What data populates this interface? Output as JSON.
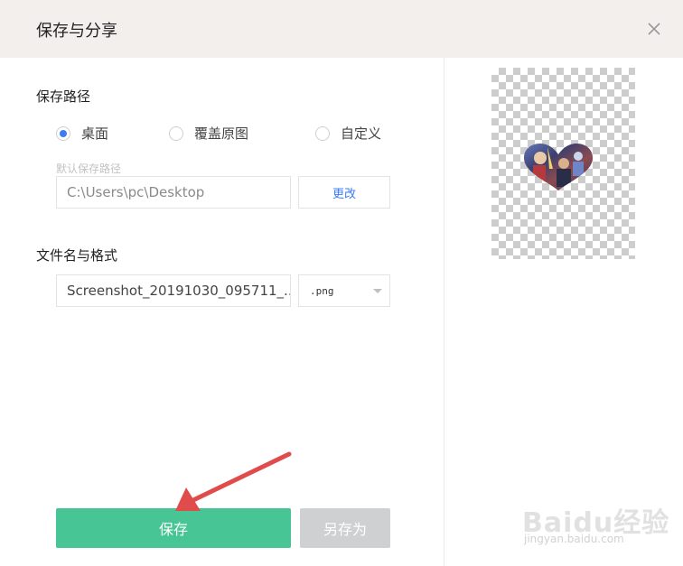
{
  "dialog": {
    "title": "保存与分享"
  },
  "save_path": {
    "label": "保存路径",
    "options": [
      {
        "label": "桌面",
        "selected": true
      },
      {
        "label": "覆盖原图",
        "selected": false
      },
      {
        "label": "自定义",
        "selected": false
      }
    ],
    "hint": "默认保存路径",
    "path_value": "C:\\Users\\pc\\Desktop",
    "change_label": "更改"
  },
  "file": {
    "label": "文件名与格式",
    "name_value": "Screenshot_20191030_095711_...",
    "format_value": ".png"
  },
  "actions": {
    "save_label": "保存",
    "save_as_label": "另存为"
  },
  "watermark": {
    "brand_text": "Baidu经验",
    "url_text": "jingyan.baidu.com"
  },
  "colors": {
    "save_button": "#47c595",
    "save_as_button": "#cfd0d2",
    "accent": "#3d7cf0",
    "titlebar": "#f3efed",
    "arrow": "#e04b4b"
  },
  "icons": {
    "close": "close-icon",
    "format_dropdown": "chevron-down-icon"
  }
}
